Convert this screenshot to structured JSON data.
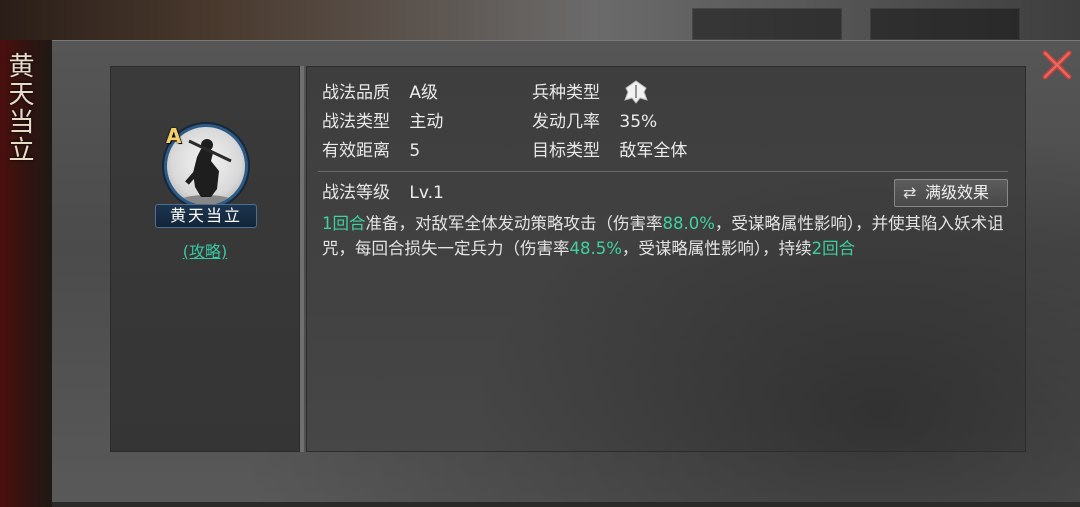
{
  "side_title": "黄天当立",
  "skill": {
    "grade_badge": "A",
    "name": "黄天当立",
    "guide_link": "(攻略)"
  },
  "info": {
    "quality_label": "战法品质",
    "quality_value": "A级",
    "unit_type_label": "兵种类型",
    "unit_type_icon": "infantry-helmet-icon",
    "type_label": "战法类型",
    "type_value": "主动",
    "trigger_label": "发动几率",
    "trigger_value": "35%",
    "range_label": "有效距离",
    "range_value": "5",
    "target_label": "目标类型",
    "target_value": "敌军全体",
    "level_label": "战法等级",
    "level_value": "Lv.1"
  },
  "max_level_button": "满级效果",
  "description": {
    "p1_hl": "1回合",
    "p1": "准备，对敌军全体发动策略攻击（伤害率",
    "p2_hl": "88.0%",
    "p2": "，受谋略属性影响），并使其陷入妖术诅咒，每回合损失一定兵力（伤害率",
    "p3_hl": "48.5%",
    "p3": "，受谋略属性影响），持续",
    "p4_hl": "2回合"
  },
  "colors": {
    "highlight": "#3fd0a0",
    "close": "#d9534f",
    "grade": "#f3d06a"
  }
}
